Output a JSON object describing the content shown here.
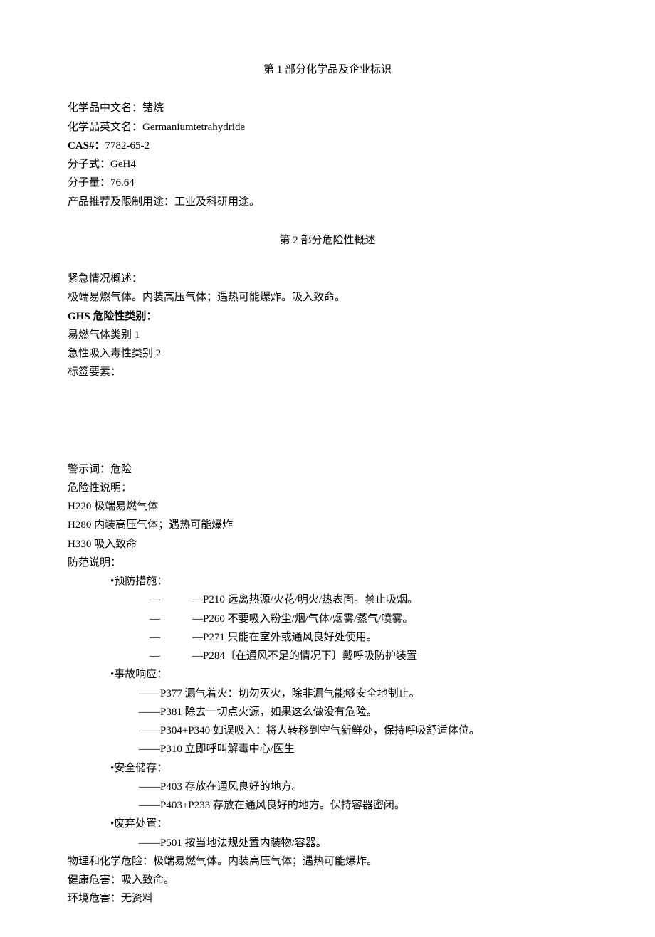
{
  "section1": {
    "title": "第 1 部分化学品及企业标识",
    "fields": {
      "name_cn_label": "化学品中文名：",
      "name_cn_value": "锗烷",
      "name_en_label": "化学品英文名：",
      "name_en_value": "Germaniumtetrahydride",
      "cas_label": "CAS#：",
      "cas_value": "7782-65-2",
      "formula_label": "分子式：",
      "formula_value": "GeH4",
      "mw_label": "分子量：",
      "mw_value": "76.64",
      "use_label": "产品推荐及限制用途：",
      "use_value": "工业及科研用途。"
    }
  },
  "section2": {
    "title": "第 2 部分危险性概述",
    "emergency_label": "紧急情况概述：",
    "emergency_text": "极端易燃气体。内装高压气体；遇热可能爆炸。吸入致命。",
    "ghs_label": "GHS 危险性类别：",
    "ghs_c1": "易燃气体类别 1",
    "ghs_c2": "急性吸入毒性类别 2",
    "label_elements": "标签要素：",
    "signal_label": "警示词：",
    "signal_value": "危险",
    "hazard_label": "危险性说明：",
    "h220": "H220 极端易燃气体",
    "h280": "H280 内装高压气体；遇热可能爆炸",
    "h330": "H330 吸入致命",
    "precaution_label": "防范说明：",
    "prevention": {
      "header": "•预防措施：",
      "p210": "—P210 远离热源/火花/明火/热表面。禁止吸烟。",
      "p260": "—P260 不要吸入粉尘/烟/气体/烟雾/蒸气/喷雾。",
      "p271": "—P271 只能在室外或通风良好处使用。",
      "p284": "—P284〔在通风不足的情况下〕戴呼吸防护装置"
    },
    "response": {
      "header": "•事故响应：",
      "p377": "——P377 漏气着火：切勿灭火，除非漏气能够安全地制止。",
      "p381": "——P381 除去一切点火源，如果这么做没有危险。",
      "p304": "——P304+P340 如误吸入：将人转移到空气新鲜处，保持呼吸舒适体位。",
      "p310": "——P310 立即呼叫解毒中心/医生"
    },
    "storage": {
      "header": "•安全储存：",
      "p403": "——P403 存放在通风良好的地方。",
      "p403_233": "——P403+P233 存放在通风良好的地方。保持容器密闭。"
    },
    "disposal": {
      "header": "•废弃处置：",
      "p501": "——P501 按当地法规处置内装物/容器。"
    },
    "physchem_label": "物理和化学危险：",
    "physchem_value": "极端易燃气体。内装高压气体；遇热可能爆炸。",
    "health_label": "健康危害：",
    "health_value": "吸入致命。",
    "env_label": "环境危害：",
    "env_value": "无资料"
  },
  "dash_sep": "—"
}
